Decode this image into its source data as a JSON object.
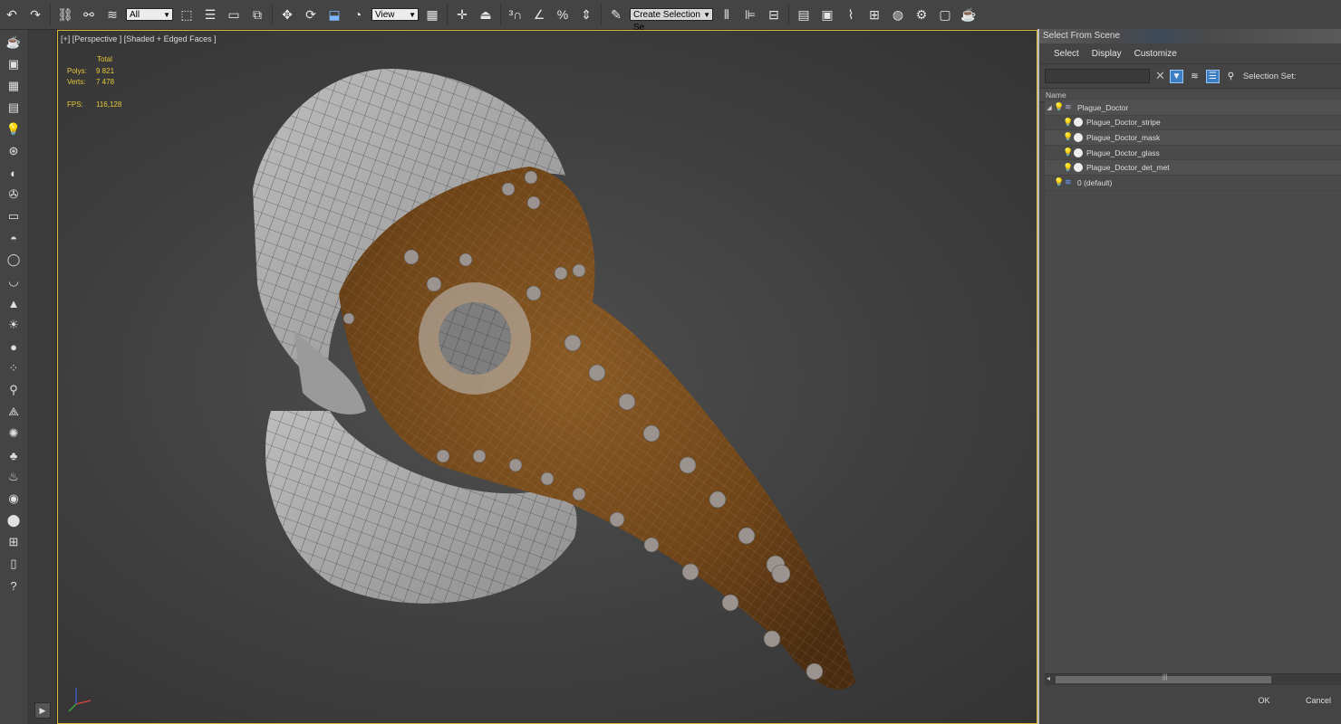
{
  "toolbar": {
    "filter_dropdown": "All",
    "coord_dropdown": "View",
    "selection_set_dropdown": "Create Selection Se",
    "buttons": [
      "undo-icon",
      "redo-icon",
      "link-icon",
      "unlink-icon",
      "bind-spacewarp-icon",
      "select-object-icon",
      "select-by-name-icon",
      "rect-region-icon",
      "window-crossing-icon",
      "move-icon",
      "rotate-icon",
      "scale-icon",
      "place-icon",
      "pivot-icon",
      "manipulate-icon",
      "keyboard-shortcut-icon",
      "snap-3d-icon",
      "angle-snap-icon",
      "percent-snap-icon",
      "spinner-snap-icon",
      "edit-named-sel-icon",
      "mirror-icon",
      "align-icon",
      "scene-explorer-icon",
      "layer-explorer-icon",
      "toggle-ribbon-icon",
      "curve-editor-icon",
      "schematic-view-icon",
      "material-editor-icon",
      "render-setup-icon",
      "rendered-frame-icon",
      "render-production-icon"
    ]
  },
  "leftbar": {
    "icons": [
      "teapot-icon",
      "viewport-config-icon",
      "grid-icon",
      "table-icon",
      "light-icon",
      "camera-tools-icon",
      "half-circle-icon",
      "film-icon",
      "box-icon",
      "dome-icon",
      "sphere-icon",
      "bowl-icon",
      "cone-icon",
      "sun-icon",
      "disc-icon",
      "particles-icon",
      "bones-icon",
      "mesh-icon",
      "globe-icon",
      "grass-icon",
      "hf-icon",
      "shell-icon",
      "ball-icon",
      "grid-plus-icon",
      "archive-icon",
      "help-icon"
    ]
  },
  "viewport": {
    "label": "[+] [Perspective ] [Shaded + Edged Faces ]",
    "stats": {
      "header": "Total",
      "polys_label": "Polys:",
      "polys_value": "9 821",
      "verts_label": "Verts:",
      "verts_value": "7 478",
      "fps_label": "FPS:",
      "fps_value": "116,128"
    }
  },
  "dialog": {
    "title": "Select From Scene",
    "menu": [
      "Select",
      "Display",
      "Customize"
    ],
    "selection_set_label": "Selection Set:",
    "column_header": "Name",
    "tree": [
      {
        "label": "Plague_Doctor",
        "level": 0,
        "kind": "layer",
        "expanded": true
      },
      {
        "label": "Plague_Doctor_stripe",
        "level": 1,
        "kind": "object"
      },
      {
        "label": "Plague_Doctor_mask",
        "level": 1,
        "kind": "object"
      },
      {
        "label": "Plague_Doctor_glass",
        "level": 1,
        "kind": "object"
      },
      {
        "label": "Plague_Doctor_det_met",
        "level": 1,
        "kind": "object"
      },
      {
        "label": "0 (default)",
        "level": 0,
        "kind": "default-layer"
      }
    ],
    "ok_label": "OK",
    "cancel_label": "Cancel"
  }
}
